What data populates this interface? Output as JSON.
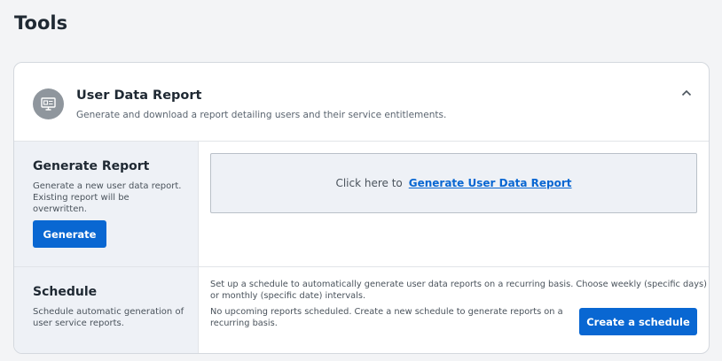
{
  "page": {
    "title": "Tools"
  },
  "card": {
    "title": "User Data Report",
    "subtitle": "Generate and download a report detailing users and their service entitlements.",
    "icon": "report-icon",
    "collapse_icon": "chevron-up-icon"
  },
  "generate": {
    "title": "Generate Report",
    "description_line1": "Generate a new user data report.",
    "description_line2": "Existing report will be",
    "description_line3": "overwritten.",
    "button_label": "Generate",
    "prompt_text": "Click here to",
    "link_text": "Generate User Data Report"
  },
  "schedule": {
    "title": "Schedule",
    "description_line1": "Schedule automatic generation of",
    "description_line2": "user service reports.",
    "info_line1": "Set up a schedule to automatically generate user data reports on a recurring basis. Choose weekly (specific days)",
    "info_line2": "or monthly (specific date) intervals.",
    "status_line1": "No upcoming reports scheduled. Create a new schedule to generate reports on a",
    "status_line2": "recurring basis.",
    "button_label": "Create a schedule"
  },
  "colors": {
    "primary": "#0967d2",
    "panel_background": "#eef1f6",
    "icon_circle": "#8f969d"
  }
}
